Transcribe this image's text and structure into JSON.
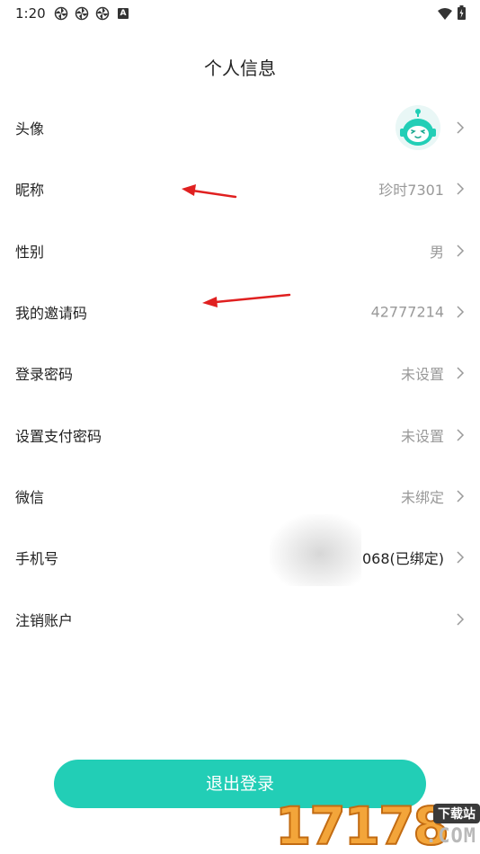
{
  "status_bar": {
    "time": "1:20",
    "notification_icons": [
      "pinwheel-icon",
      "pinwheel-icon",
      "pinwheel-icon",
      "a-icon"
    ],
    "a_icon_text": "A",
    "right_icons": [
      "wifi-icon",
      "battery-charging-icon"
    ]
  },
  "header": {
    "title": "个人信息"
  },
  "profile": {
    "avatar": {
      "label": "头像",
      "icon": "robot-avatar-icon",
      "color": "#22ceb6"
    },
    "nickname": {
      "label": "昵称",
      "value": "珍时7301"
    },
    "gender": {
      "label": "性别",
      "value": "男"
    },
    "invite_code": {
      "label": "我的邀请码",
      "value": "42777214"
    },
    "login_password": {
      "label": "登录密码",
      "value": "未设置"
    },
    "pay_password": {
      "label": "设置支付密码",
      "value": "未设置"
    },
    "wechat": {
      "label": "微信",
      "value": "未绑定"
    },
    "phone": {
      "label": "手机号",
      "value": "068(已绑定)"
    },
    "cancel_account": {
      "label": "注销账户"
    }
  },
  "logout_button": {
    "label": "退出登录",
    "color": "#22ceb6"
  },
  "annotations": {
    "arrow_color": "#e02020"
  },
  "watermark": {
    "digits": "17178",
    "tag": "下载站",
    "suffix": ".COM"
  }
}
